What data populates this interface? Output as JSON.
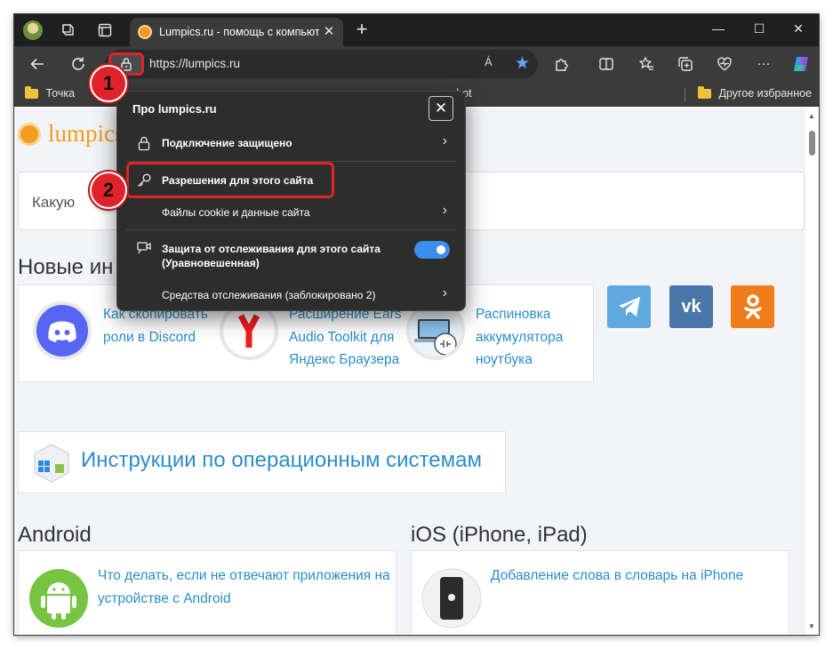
{
  "tab": {
    "title": "Lumpics.ru - помощь с компьютером",
    "close": "✕",
    "new_tab": "+"
  },
  "window_controls": {
    "minimize": "—",
    "maximize": "☐",
    "close": "✕"
  },
  "address_bar": {
    "url": "https://lumpics.ru",
    "read_aloud": "Á"
  },
  "bookmarks": {
    "left_item": "Точка",
    "partial_item": "shot",
    "other_favorites": "Другое избранное"
  },
  "page": {
    "logo": "lumpics",
    "search_placeholder": "Какую",
    "new_section_partial": "Новые ин",
    "articles": [
      "Как скопировать роли в Discord",
      "Расширение Ears Audio Toolkit для Яндекс Браузера",
      "Распиновка аккумулятора ноутбука"
    ],
    "os_section": "Инструкции по операционным системам",
    "android_title": "Android",
    "ios_title": "iOS (iPhone, iPad)",
    "android_article": "Что делать, если не отвечают приложения на устройстве с Android",
    "ios_article": "Добавление слова в словарь на iPhone"
  },
  "flyout": {
    "title": "Про lumpics.ru",
    "close": "✕",
    "items": [
      "Подключение защищено",
      "Разрешения для этого сайта",
      "Файлы cookie и данные сайта",
      "Защита от отслеживания для этого сайта (Уравновешенная)",
      "Средства отслеживания (заблокировано 2)"
    ],
    "tracking_toggle_on": true
  },
  "annotations": {
    "step1": "1",
    "step2": "2"
  },
  "colors": {
    "accent_red": "#e0222a",
    "link_blue": "#2b8ec9",
    "toggle_blue": "#3b8eea",
    "brand_orange": "#f39c22"
  }
}
